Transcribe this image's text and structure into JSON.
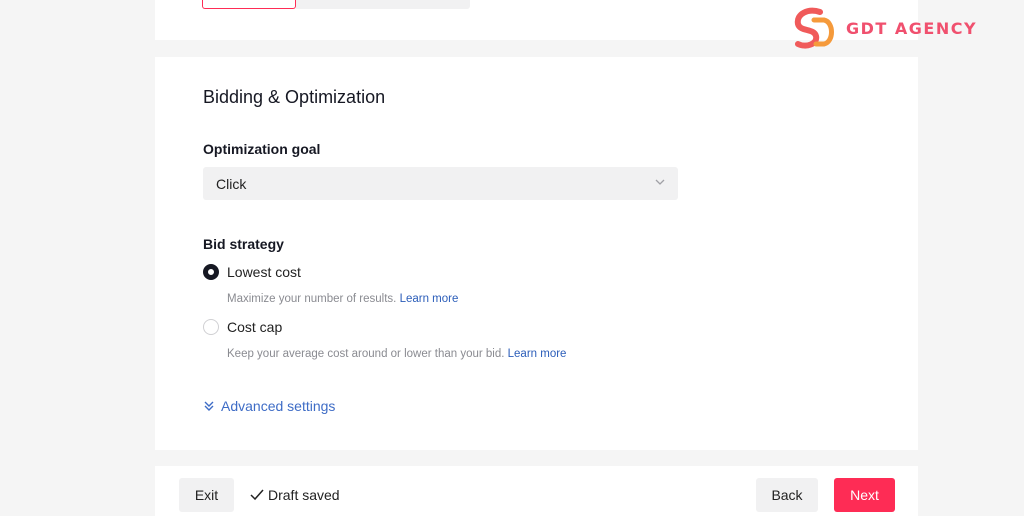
{
  "logo": {
    "text": "GDT AGENCY",
    "brand_color": "#f0506e"
  },
  "section": {
    "title": "Bidding & Optimization",
    "optimization_goal": {
      "label": "Optimization goal",
      "value": "Click"
    },
    "bid_strategy": {
      "label": "Bid strategy",
      "options": [
        {
          "label": "Lowest cost",
          "checked": true,
          "hint": "Maximize your number of results.",
          "link": "Learn more"
        },
        {
          "label": "Cost cap",
          "checked": false,
          "hint": "Keep your average cost around or lower than your bid.",
          "link": "Learn more"
        }
      ]
    },
    "advanced_settings": "Advanced settings"
  },
  "footer": {
    "exit_label": "Exit",
    "draft_status": "Draft saved",
    "back_label": "Back",
    "next_label": "Next"
  },
  "colors": {
    "accent": "#fe2c55",
    "link": "#2b5db9"
  }
}
